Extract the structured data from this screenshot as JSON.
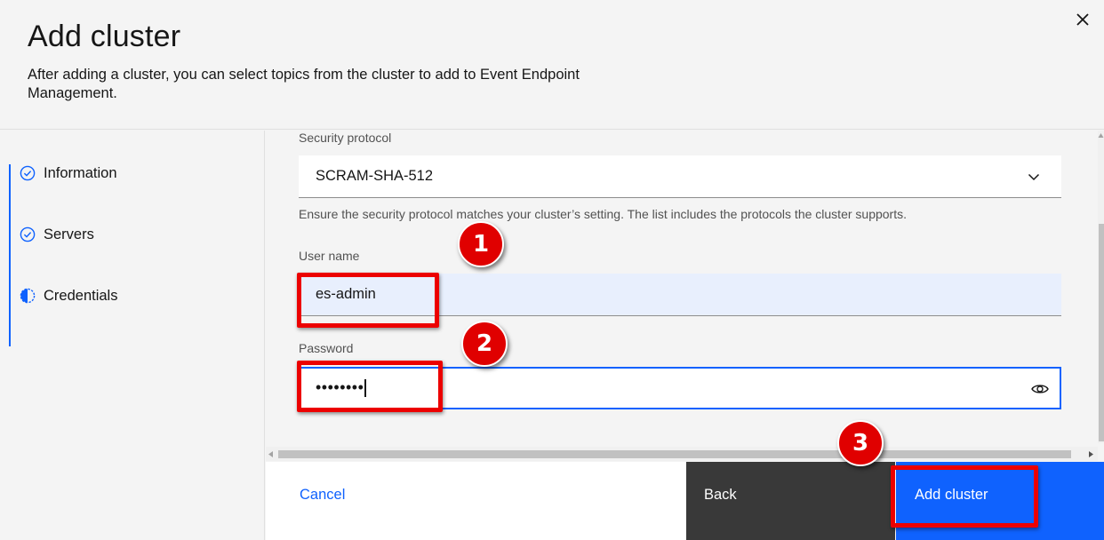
{
  "modal": {
    "title": "Add cluster",
    "subtitle": "After adding a cluster, you can select topics from the cluster to add to Event Endpoint Management."
  },
  "steps": [
    {
      "label": "Information",
      "status": "complete",
      "icon": "checkmark-circle-icon"
    },
    {
      "label": "Servers",
      "status": "complete",
      "icon": "checkmark-circle-icon"
    },
    {
      "label": "Credentials",
      "status": "current",
      "icon": "half-circle-icon"
    }
  ],
  "form": {
    "security_protocol": {
      "label": "Security protocol",
      "value": "SCRAM-SHA-512",
      "helper": "Ensure the security protocol matches your cluster’s setting. The list includes the protocols the cluster supports."
    },
    "username": {
      "label": "User name",
      "value": "es-admin"
    },
    "password": {
      "label": "Password",
      "value": "••••••••"
    }
  },
  "footer": {
    "cancel": "Cancel",
    "back": "Back",
    "add": "Add cluster"
  },
  "annotations": [
    "1",
    "2",
    "3"
  ],
  "colors": {
    "accent": "#0f62fe",
    "annotation_red": "#e00000",
    "dark_button": "#393939"
  }
}
